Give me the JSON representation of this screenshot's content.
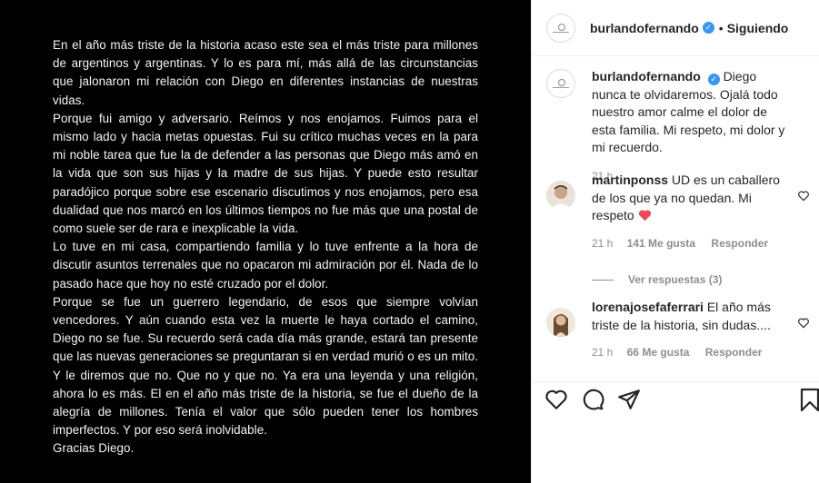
{
  "post": {
    "paragraphs": [
      "En el año más triste de la historia acaso este sea el más triste para millones de argentinos y argentinas. Y lo es para mí, más allá de las circunstancias que jalonaron mi relación con Diego en diferentes instancias de nuestras vidas.",
      "Porque fui amigo y adversario. Reímos y nos enojamos. Fuimos para el mismo lado y hacia metas opuestas. Fui su crítico muchas veces en la para mi noble tarea que fue la de defender a las personas que Diego más amó en la vida que son sus hijas y la madre de sus hijas. Y puede esto resultar paradójico porque sobre ese escenario discutimos y nos enojamos, pero esa dualidad que nos marcó en los últimos tiempos no fue más que una postal de como suele ser de rara e inexplicable la vida.",
      "Lo tuve en mi casa, compartiendo familia y lo tuve enfrente a la hora de discutir asuntos terrenales que no opacaron mi admiración por él. Nada de lo pasado hace que hoy no esté cruzado por el dolor.",
      "Porque se fue un guerrero legendario, de esos que siempre volvían vencedores. Y aún cuando esta vez la muerte le haya cortado el camino, Diego no se fue. Su recuerdo será cada día más grande, estará tan presente que las nuevas generaciones se preguntaran si en verdad murió o es un mito. Y le diremos que no. Que no y que no. Ya era una leyenda y una religión, ahora lo es más. El en el año más triste de la historia, se fue el dueño de la alegría de millones. Tenía el valor que sólo pueden tener los hombres imperfectos. Y por eso será inolvidable.",
      "Gracias Diego."
    ]
  },
  "header": {
    "username": "burlandofernando",
    "dot": "•",
    "follow_status": "Siguiendo",
    "verified_glyph": "✓"
  },
  "caption": {
    "username": "burlandofernando",
    "text": "Diego nunca te olvidaremos. Ojalá todo nuestro amor calme el dolor de esta familia. Mi respeto, mi dolor y mi recuerdo.",
    "time": "21 h"
  },
  "comments": [
    {
      "username": "martinponss",
      "text": "UD es un caballero de los que ya no quedan. Mi respeto",
      "emoji": "❤️",
      "time": "21 h",
      "likes": "141 Me gusta",
      "reply": "Responder"
    },
    {
      "username": "lorenajosefaferrari",
      "text": "El año más triste de la historia, sin dudas....",
      "time": "21 h",
      "likes": "66 Me gusta",
      "reply": "Responder"
    }
  ],
  "view_replies": "Ver respuestas (3)",
  "icons": [
    "heart-icon",
    "comment-icon",
    "share-icon",
    "bookmark-icon"
  ],
  "colors": {
    "verified": "#3897f0",
    "heart_emoji": "#ed4956",
    "muted": "#8e8e8e"
  }
}
